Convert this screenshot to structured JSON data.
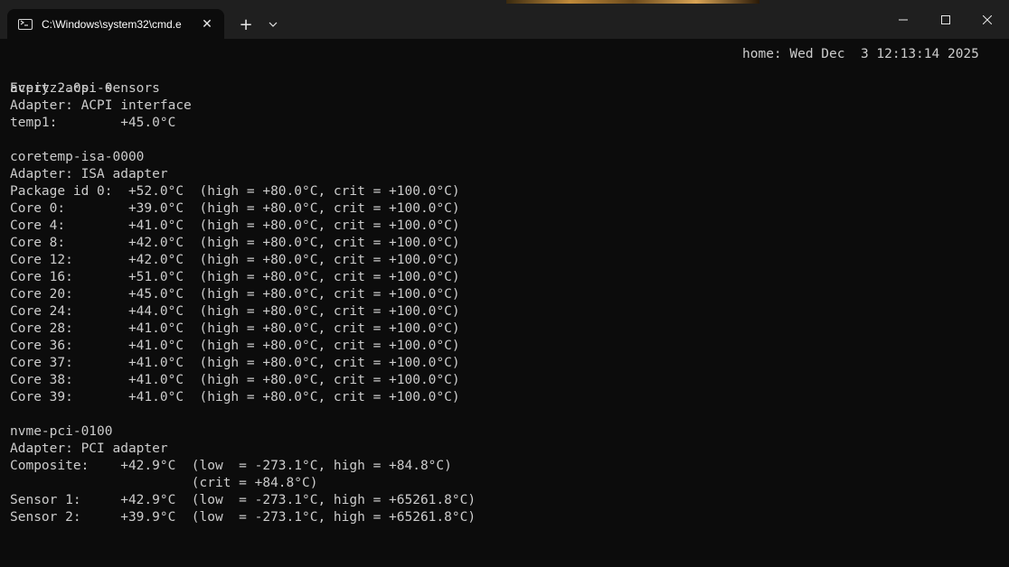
{
  "window": {
    "tab_title": "C:\\Windows\\system32\\cmd.e",
    "close_tab_glyph": "✕",
    "new_tab_glyph": "+",
    "icons": {
      "tab_icon": "terminal-icon",
      "dropdown": "chevron-down-icon",
      "minimize": "minimize-icon",
      "maximize": "maximize-icon",
      "close": "close-icon"
    }
  },
  "terminal": {
    "header_left": "Every 2.0s: sensors",
    "header_right": "home: Wed Dec  3 12:13:14 2025",
    "lines": [
      "acpitz-acpi-0",
      "Adapter: ACPI interface",
      "temp1:        +45.0°C",
      "",
      "coretemp-isa-0000",
      "Adapter: ISA adapter",
      "Package id 0:  +52.0°C  (high = +80.0°C, crit = +100.0°C)",
      "Core 0:        +39.0°C  (high = +80.0°C, crit = +100.0°C)",
      "Core 4:        +41.0°C  (high = +80.0°C, crit = +100.0°C)",
      "Core 8:        +42.0°C  (high = +80.0°C, crit = +100.0°C)",
      "Core 12:       +42.0°C  (high = +80.0°C, crit = +100.0°C)",
      "Core 16:       +51.0°C  (high = +80.0°C, crit = +100.0°C)",
      "Core 20:       +45.0°C  (high = +80.0°C, crit = +100.0°C)",
      "Core 24:       +44.0°C  (high = +80.0°C, crit = +100.0°C)",
      "Core 28:       +41.0°C  (high = +80.0°C, crit = +100.0°C)",
      "Core 36:       +41.0°C  (high = +80.0°C, crit = +100.0°C)",
      "Core 37:       +41.0°C  (high = +80.0°C, crit = +100.0°C)",
      "Core 38:       +41.0°C  (high = +80.0°C, crit = +100.0°C)",
      "Core 39:       +41.0°C  (high = +80.0°C, crit = +100.0°C)",
      "",
      "nvme-pci-0100",
      "Adapter: PCI adapter",
      "Composite:    +42.9°C  (low  = -273.1°C, high = +84.8°C)",
      "                       (crit = +84.8°C)",
      "Sensor 1:     +42.9°C  (low  = -273.1°C, high = +65261.8°C)",
      "Sensor 2:     +39.9°C  (low  = -273.1°C, high = +65261.8°C)"
    ]
  }
}
